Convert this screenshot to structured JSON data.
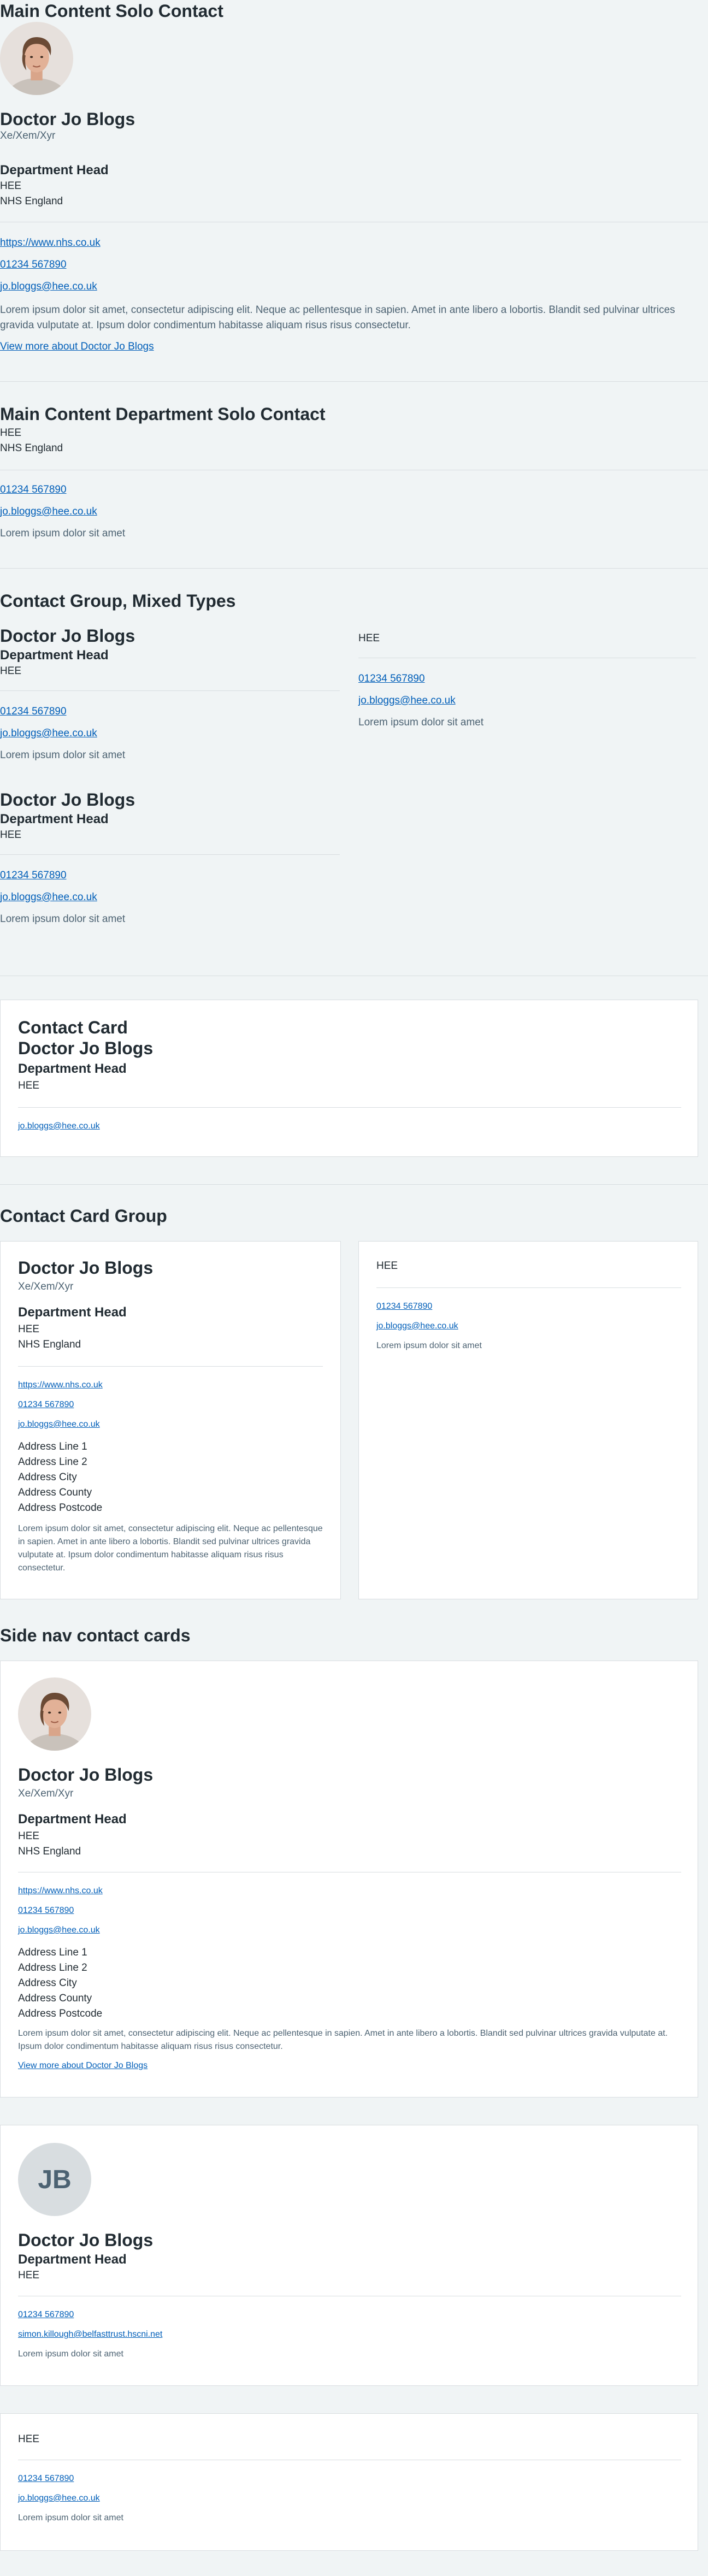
{
  "s1": {
    "title": "Main Content Solo Contact",
    "name": "Doctor Jo Blogs",
    "pronouns": "Xe/Xem/Xyr",
    "role": "Department Head",
    "org": "HEE",
    "region": "NHS England",
    "website": "https://www.nhs.co.uk",
    "phone": "01234 567890",
    "email": "jo.bloggs@hee.co.uk",
    "desc": "Lorem ipsum dolor sit amet, consectetur adipiscing elit. Neque ac pellentesque in sapien. Amet in ante libero a lobortis. Blandit sed pulvinar ultrices gravida vulputate at. Ipsum dolor condimentum habitasse aliquam risus risus consectetur.",
    "more": "View more about Doctor Jo Blogs"
  },
  "s2": {
    "title": "Main Content Department Solo Contact",
    "org": "HEE",
    "region": "NHS England",
    "phone": "01234 567890",
    "email": "jo.bloggs@hee.co.uk",
    "desc": "Lorem ipsum dolor sit amet"
  },
  "s3": {
    "title": "Contact Group, Mixed Types",
    "a": {
      "name": "Doctor Jo Blogs",
      "role": "Department Head",
      "org": "HEE",
      "phone": "01234 567890",
      "email": "jo.bloggs@hee.co.uk",
      "desc": "Lorem ipsum dolor sit amet"
    },
    "b": {
      "org": "HEE",
      "phone": "01234 567890",
      "email": "jo.bloggs@hee.co.uk",
      "desc": "Lorem ipsum dolor sit amet"
    },
    "c": {
      "name": "Doctor Jo Blogs",
      "role": "Department Head",
      "org": "HEE",
      "phone": "01234 567890",
      "email": "jo.bloggs@hee.co.uk",
      "desc": "Lorem ipsum dolor sit amet"
    }
  },
  "s4": {
    "title": "Contact Card",
    "name": "Doctor Jo Blogs",
    "role": "Department Head",
    "org": "HEE",
    "email": "jo.bloggs@hee.co.uk"
  },
  "s5": {
    "title": "Contact Card Group",
    "left": {
      "name": "Doctor Jo Blogs",
      "pronouns": "Xe/Xem/Xyr",
      "role": "Department Head",
      "org": "HEE",
      "region": "NHS England",
      "website": "https://www.nhs.co.uk",
      "phone": "01234 567890",
      "email": "jo.bloggs@hee.co.uk",
      "address": [
        "Address Line 1",
        "Address Line 2",
        "Address City",
        "Address County",
        "Address Postcode"
      ],
      "desc": "Lorem ipsum dolor sit amet, consectetur adipiscing elit. Neque ac pellentesque in sapien. Amet in ante libero a lobortis. Blandit sed pulvinar ultrices gravida vulputate at. Ipsum dolor condimentum habitasse aliquam risus risus consectetur."
    },
    "right": {
      "org": "HEE",
      "phone": "01234 567890",
      "email": "jo.bloggs@hee.co.uk",
      "desc": "Lorem ipsum dolor sit amet"
    }
  },
  "s6": {
    "title": "Side nav contact cards",
    "c1": {
      "name": "Doctor Jo Blogs",
      "pronouns": "Xe/Xem/Xyr",
      "role": "Department Head",
      "org": "HEE",
      "region": "NHS England",
      "website": "https://www.nhs.co.uk",
      "phone": "01234 567890",
      "email": "jo.bloggs@hee.co.uk",
      "address": [
        "Address Line 1",
        "Address Line 2",
        "Address City",
        "Address County",
        "Address Postcode"
      ],
      "desc": "Lorem ipsum dolor sit amet, consectetur adipiscing elit. Neque ac pellentesque in sapien. Amet in ante libero a lobortis. Blandit sed pulvinar ultrices gravida vulputate at. Ipsum dolor condimentum habitasse aliquam risus risus consectetur.",
      "more": "View more about Doctor Jo Blogs"
    },
    "c2": {
      "initials": "JB",
      "name": "Doctor Jo Blogs",
      "role": "Department Head",
      "org": "HEE",
      "phone": "01234 567890",
      "email": "simon.killough@belfasttrust.hscni.net",
      "desc": "Lorem ipsum dolor sit amet"
    },
    "c3": {
      "org": "HEE",
      "phone": "01234 567890",
      "email": "jo.bloggs@hee.co.uk",
      "desc": "Lorem ipsum dolor sit amet"
    }
  },
  "colors": {
    "background": "#f0f4f5",
    "card": "#ffffff",
    "link": "#005eb8",
    "text": "#212b32",
    "secondary": "#4c6272",
    "divider": "#d8dde0"
  }
}
